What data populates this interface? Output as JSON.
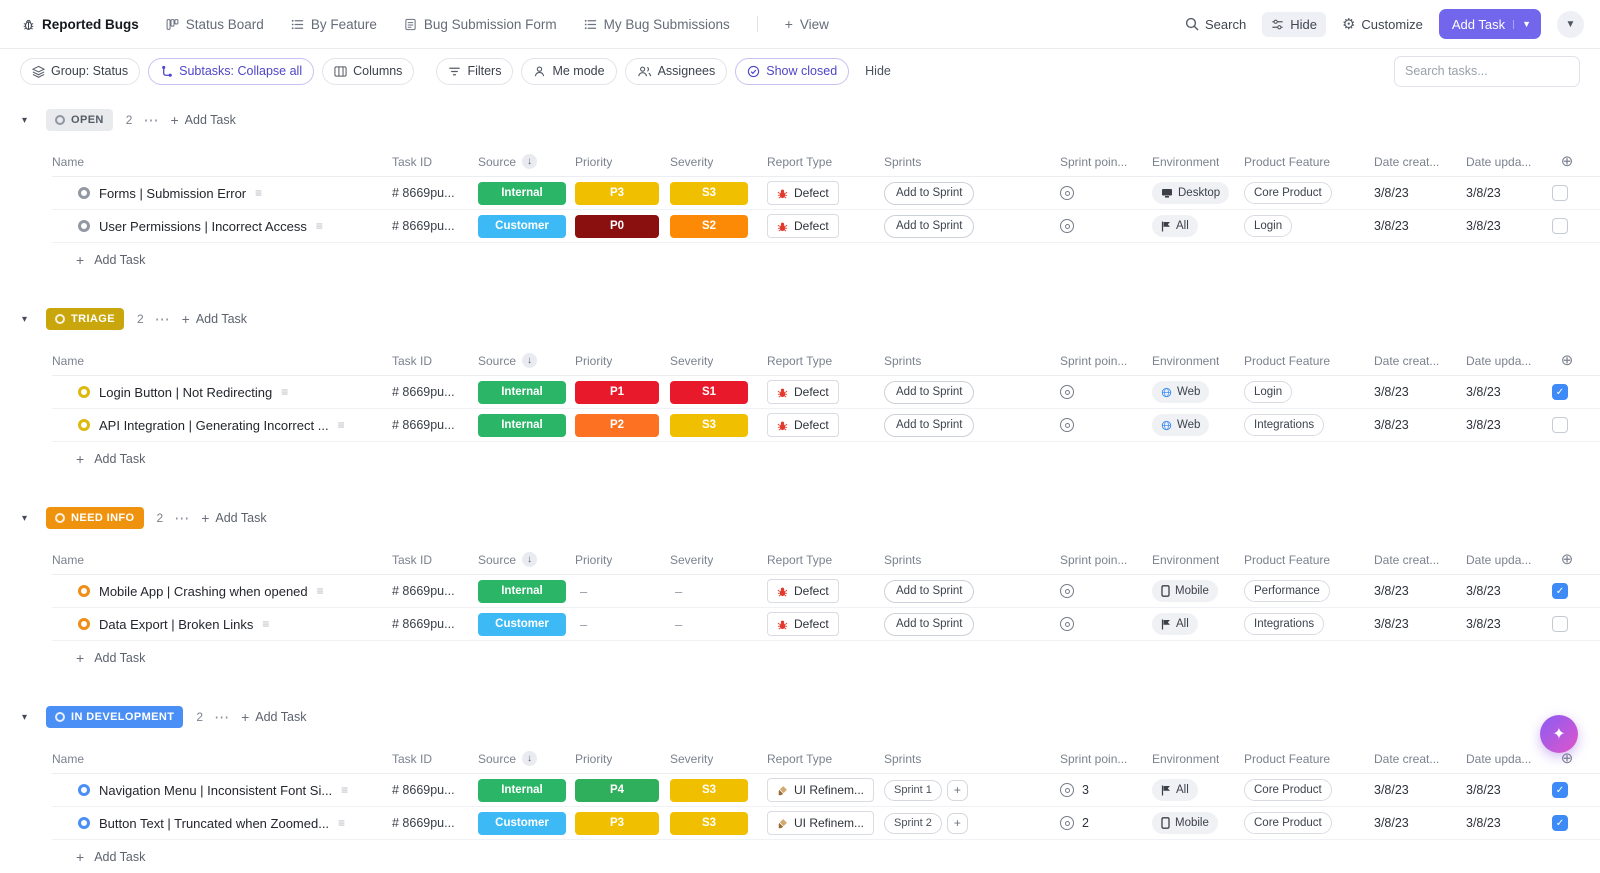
{
  "colors": {
    "accent": "#7166ec",
    "checkbox_checked": "#3e8bf8"
  },
  "topnav": {
    "tabs": [
      {
        "label": "Reported Bugs"
      },
      {
        "label": "Status Board"
      },
      {
        "label": "By Feature"
      },
      {
        "label": "Bug Submission Form"
      },
      {
        "label": "My Bug Submissions"
      }
    ],
    "view": "View",
    "search": "Search",
    "hide": "Hide",
    "customize": "Customize",
    "add_task": "Add Task"
  },
  "toolbar": {
    "group_by": "Group: Status",
    "subtasks": "Subtasks: Collapse all",
    "columns": "Columns",
    "filters": "Filters",
    "me_mode": "Me mode",
    "assignees": "Assignees",
    "show_closed": "Show closed",
    "hide": "Hide",
    "search_placeholder": "Search tasks..."
  },
  "labels": {
    "add_task": "Add Task"
  },
  "table": {
    "columns": [
      "Name",
      "Task ID",
      "Source",
      "Priority",
      "Severity",
      "Report Type",
      "Sprints",
      "Sprint poin...",
      "Environment",
      "Product Feature",
      "Date creat...",
      "Date upda..."
    ]
  },
  "groups": [
    {
      "name": "OPEN",
      "count": "2",
      "badge_bg": "#e8eaee",
      "badge_fg": "#555c66",
      "badge_dot": "#8f96a0",
      "row_dot": "#9299a3",
      "tasks": [
        {
          "name": "Forms | Submission Error",
          "task_id": "# 8669pu...",
          "source": "Internal",
          "source_color": "#2bb567",
          "priority": "P3",
          "priority_color": "#f0c000",
          "severity": "S3",
          "severity_color": "#f0c000",
          "report_type": "Defect",
          "report_icon": "bug",
          "sprint": "Add to Sprint",
          "sprint_type": "add",
          "points": "",
          "environment": "Desktop",
          "env_icon": "desktop",
          "feature": "Core Product",
          "date_created": "3/8/23",
          "date_updated": "3/8/23",
          "checked": false
        },
        {
          "name": "User Permissions | Incorrect Access",
          "task_id": "# 8669pu...",
          "source": "Customer",
          "source_color": "#3db9f5",
          "priority": "P0",
          "priority_color": "#8a0f0f",
          "severity": "S2",
          "severity_color": "#fc8a06",
          "report_type": "Defect",
          "report_icon": "bug",
          "sprint": "Add to Sprint",
          "sprint_type": "add",
          "points": "",
          "environment": "All",
          "env_icon": "flag",
          "feature": "Login",
          "date_created": "3/8/23",
          "date_updated": "3/8/23",
          "checked": false
        }
      ]
    },
    {
      "name": "TRIAGE",
      "count": "2",
      "badge_bg": "#c9a60b",
      "badge_fg": "#ffffff",
      "badge_dot": "#ffffffd9",
      "row_dot": "#ddb80e",
      "tasks": [
        {
          "name": "Login Button | Not Redirecting",
          "task_id": "# 8669pu...",
          "source": "Internal",
          "source_color": "#2bb567",
          "priority": "P1",
          "priority_color": "#e8192b",
          "severity": "S1",
          "severity_color": "#e8192b",
          "report_type": "Defect",
          "report_icon": "bug",
          "sprint": "Add to Sprint",
          "sprint_type": "add",
          "points": "",
          "environment": "Web",
          "env_icon": "globe",
          "feature": "Login",
          "date_created": "3/8/23",
          "date_updated": "3/8/23",
          "checked": true
        },
        {
          "name": "API Integration | Generating Incorrect ...",
          "task_id": "# 8669pu...",
          "source": "Internal",
          "source_color": "#2bb567",
          "priority": "P2",
          "priority_color": "#fd7122",
          "severity": "S3",
          "severity_color": "#f0c000",
          "report_type": "Defect",
          "report_icon": "bug",
          "sprint": "Add to Sprint",
          "sprint_type": "add",
          "points": "",
          "environment": "Web",
          "env_icon": "globe",
          "feature": "Integrations",
          "date_created": "3/8/23",
          "date_updated": "3/8/23",
          "checked": false
        }
      ]
    },
    {
      "name": "NEED INFO",
      "count": "2",
      "badge_bg": "#ef920d",
      "badge_fg": "#ffffff",
      "badge_dot": "#ffffffd9",
      "row_dot": "#ef8d15",
      "tasks": [
        {
          "name": "Mobile App | Crashing when opened",
          "task_id": "# 8669pu...",
          "source": "Internal",
          "source_color": "#2bb567",
          "priority": "",
          "priority_color": "",
          "severity": "",
          "severity_color": "",
          "report_type": "Defect",
          "report_icon": "bug",
          "sprint": "Add to Sprint",
          "sprint_type": "add",
          "points": "",
          "environment": "Mobile",
          "env_icon": "mobile",
          "feature": "Performance",
          "date_created": "3/8/23",
          "date_updated": "3/8/23",
          "checked": true
        },
        {
          "name": "Data Export | Broken Links",
          "task_id": "# 8669pu...",
          "source": "Customer",
          "source_color": "#3db9f5",
          "priority": "",
          "priority_color": "",
          "severity": "",
          "severity_color": "",
          "report_type": "Defect",
          "report_icon": "bug",
          "sprint": "Add to Sprint",
          "sprint_type": "add",
          "points": "",
          "environment": "All",
          "env_icon": "flag",
          "feature": "Integrations",
          "date_created": "3/8/23",
          "date_updated": "3/8/23",
          "checked": false
        }
      ]
    },
    {
      "name": "IN DEVELOPMENT",
      "count": "2",
      "badge_bg": "#4a8ff5",
      "badge_fg": "#ffffff",
      "badge_dot": "#ffffffd9",
      "row_dot": "#4a8ff5",
      "tasks": [
        {
          "name": "Navigation Menu | Inconsistent Font Si...",
          "task_id": "# 8669pu...",
          "source": "Internal",
          "source_color": "#2bb567",
          "priority": "P4",
          "priority_color": "#2fae5b",
          "severity": "S3",
          "severity_color": "#f0c000",
          "report_type": "UI Refinem...",
          "report_icon": "brush",
          "sprint": "Sprint 1",
          "sprint_type": "sprint",
          "points": "3",
          "environment": "All",
          "env_icon": "flag",
          "feature": "Core Product",
          "date_created": "3/8/23",
          "date_updated": "3/8/23",
          "checked": true
        },
        {
          "name": "Button Text | Truncated when Zoomed...",
          "task_id": "# 8669pu...",
          "source": "Customer",
          "source_color": "#3db9f5",
          "priority": "P3",
          "priority_color": "#f0c000",
          "severity": "S3",
          "severity_color": "#f0c000",
          "report_type": "UI Refinem...",
          "report_icon": "brush",
          "sprint": "Sprint 2",
          "sprint_type": "sprint",
          "points": "2",
          "environment": "Mobile",
          "env_icon": "mobile",
          "feature": "Core Product",
          "date_created": "3/8/23",
          "date_updated": "3/8/23",
          "checked": true
        }
      ]
    }
  ]
}
